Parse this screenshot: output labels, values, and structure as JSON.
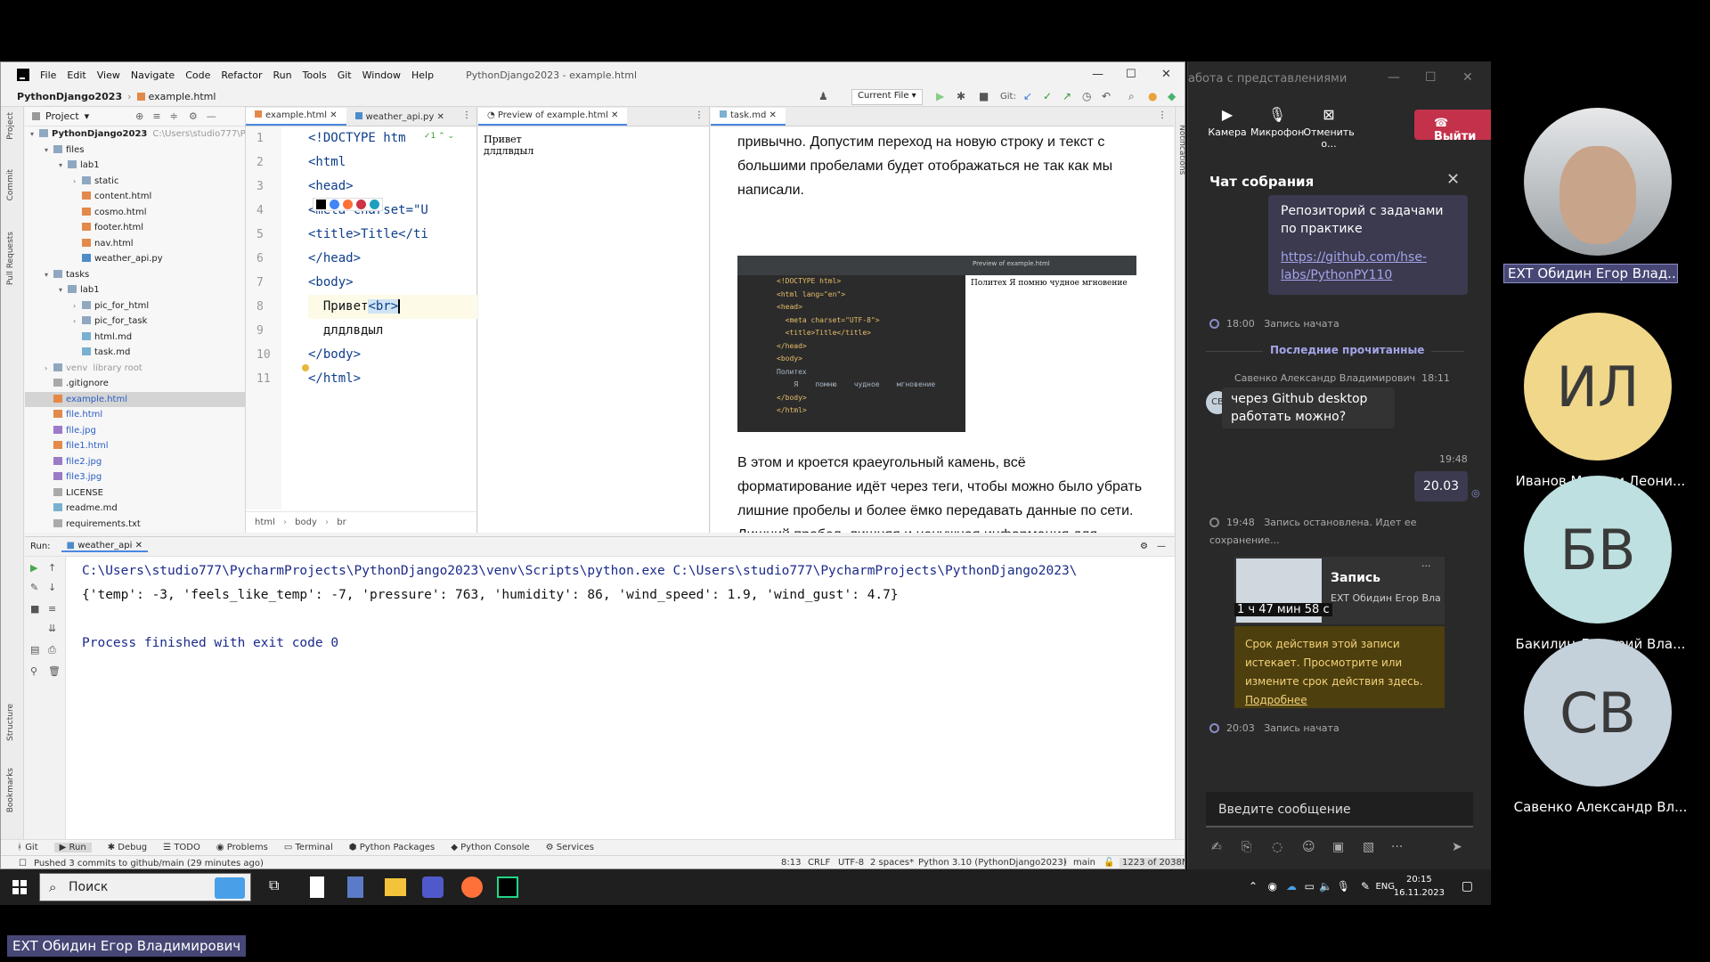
{
  "ide": {
    "menu": [
      "File",
      "Edit",
      "View",
      "Navigate",
      "Code",
      "Refactor",
      "Run",
      "Tools",
      "Git",
      "Window",
      "Help"
    ],
    "title": "PythonDjango2023 - example.html",
    "nav_project": "PythonDjango2023",
    "nav_file": "example.html",
    "run_config": "Current File",
    "git_label": "Git:",
    "left_strip": [
      "Project",
      "Commit",
      "Pull Requests",
      "Structure",
      "Bookmarks"
    ],
    "right_strip": "Notifications",
    "project_label": "Project",
    "tree": [
      {
        "label": "PythonDjango2023",
        "extra": "C:\\Users\\studio777\\Py",
        "indent": 0,
        "type": "folder",
        "arrow": "▾",
        "bold": true
      },
      {
        "label": "files",
        "indent": 1,
        "type": "folder",
        "arrow": "▾"
      },
      {
        "label": "lab1",
        "indent": 2,
        "type": "folder",
        "arrow": "▾"
      },
      {
        "label": "static",
        "indent": 3,
        "type": "folder",
        "arrow": "›"
      },
      {
        "label": "content.html",
        "indent": 3,
        "type": "fhtml"
      },
      {
        "label": "cosmo.html",
        "indent": 3,
        "type": "fhtml"
      },
      {
        "label": "footer.html",
        "indent": 3,
        "type": "fhtml"
      },
      {
        "label": "nav.html",
        "indent": 3,
        "type": "fhtml"
      },
      {
        "label": "weather_api.py",
        "indent": 3,
        "type": "fpy"
      },
      {
        "label": "tasks",
        "indent": 1,
        "type": "folder",
        "arrow": "▾"
      },
      {
        "label": "lab1",
        "indent": 2,
        "type": "folder",
        "arrow": "▾"
      },
      {
        "label": "pic_for_html",
        "indent": 3,
        "type": "folder",
        "arrow": "›"
      },
      {
        "label": "pic_for_task",
        "indent": 3,
        "type": "folder",
        "arrow": "›"
      },
      {
        "label": "html.md",
        "indent": 3,
        "type": "fmd"
      },
      {
        "label": "task.md",
        "indent": 3,
        "type": "fmd"
      },
      {
        "label": "venv",
        "extra": "library root",
        "indent": 1,
        "type": "folder",
        "arrow": "›",
        "gray": true
      },
      {
        "label": ".gitignore",
        "indent": 1,
        "type": "ftxt"
      },
      {
        "label": "example.html",
        "indent": 1,
        "type": "fhtml",
        "selected": true,
        "blue": true
      },
      {
        "label": "file.html",
        "indent": 1,
        "type": "fhtml",
        "blue": true
      },
      {
        "label": "file.jpg",
        "indent": 1,
        "type": "fjpg",
        "blue": true
      },
      {
        "label": "file1.html",
        "indent": 1,
        "type": "fhtml",
        "blue": true
      },
      {
        "label": "file2.jpg",
        "indent": 1,
        "type": "fjpg",
        "blue": true
      },
      {
        "label": "file3.jpg",
        "indent": 1,
        "type": "fjpg",
        "blue": true
      },
      {
        "label": "LICENSE",
        "indent": 1,
        "type": "ftxt"
      },
      {
        "label": "readme.md",
        "indent": 1,
        "type": "fmd"
      },
      {
        "label": "requirements.txt",
        "indent": 1,
        "type": "ftxt"
      }
    ],
    "editor_tabs": [
      "example.html",
      "weather_api.py"
    ],
    "preview_tab": "Preview of example.html",
    "md_tab": "task.md",
    "line_numbers": [
      "1",
      "2",
      "3",
      "4",
      "5",
      "6",
      "7",
      "8",
      "9",
      "10",
      "11"
    ],
    "code_lines": [
      {
        "html": "<!DOCTYPE htm"
      },
      {
        "html": "<html"
      },
      {
        "html": "<head>"
      },
      {
        "html": "    <meta charset=\"U"
      },
      {
        "html": "    <title>Title</ti"
      },
      {
        "html": "</head>"
      },
      {
        "html": "<body>"
      },
      {
        "text": "  Привет",
        "tag": "<br>"
      },
      {
        "text": "  длдлвдыл"
      },
      {
        "html": "</body>"
      },
      {
        "html": "</html>"
      }
    ],
    "breadcrumb": [
      "html",
      "body",
      "br"
    ],
    "preview_text": [
      "Привет",
      "длдлвдыл"
    ],
    "md_para1": "привычно. Допустим переход на новую строку и текст с большими пробелами будет отображаться не так как мы написали.",
    "md_para2": "В этом и кроется краеугольный камень, всё форматирование идёт через теги, чтобы можно было убрать лишние пробелы и более ёмко передавать данные по сети. Лишний пробел, лишняя и ненужная информация для компьютера, хотя человеку и приятнее",
    "md_img_code": [
      "<!DOCTYPE html>",
      "<html lang=\"en\">",
      "<head>",
      "  <meta charset=\"UTF-8\">",
      "  <title>Title</title>",
      "</head>",
      "<body>",
      "Политех",
      "    Я    помню    чудное    мгновение",
      "</body>",
      "</html>"
    ],
    "md_img_preview": "Политех Я помню чудное мгновение",
    "md_img_tab": "Preview of example.html",
    "run_label": "Run:",
    "run_config_tab": "weather_api",
    "output": {
      "cmd": "C:\\Users\\studio777\\PycharmProjects\\PythonDjango2023\\venv\\Scripts\\python.exe C:\\Users\\studio777\\PycharmProjects\\PythonDjango2023\\",
      "result": "{'temp': -3, 'feels_like_temp': -7, 'pressure': 763, 'humidity': 86, 'wind_speed': 1.9, 'wind_gust': 4.7}",
      "exit": "Process finished with exit code 0"
    },
    "bottom_tabs": [
      "Git",
      "Run",
      "Debug",
      "TODO",
      "Problems",
      "Terminal",
      "Python Packages",
      "Python Console",
      "Services"
    ],
    "status_msg": "Pushed 3 commits to github/main (29 minutes ago)",
    "status_right": {
      "pos": "8:13",
      "eol": "CRLF",
      "enc": "UTF-8",
      "indent": "2 spaces*",
      "interp": "Python 3.10 (PythonDjango2023)",
      "branch": "main",
      "mem": "1223 of 2038M"
    }
  },
  "taskbar": {
    "search": "Поиск",
    "lang": "ENG",
    "time": "20:15",
    "date": "16.11.2023"
  },
  "teams": {
    "window_title": "абота с представлениями",
    "controls": [
      "Камера",
      "Микрофон",
      "Отменить о..."
    ],
    "leave": "Выйти",
    "chat_title": "Чат собрания",
    "repo_msg": "Репозиторий с задачами по практике",
    "repo_link": "https://github.com/hse-labs/PythonPY110",
    "rec_start1_time": "18:00",
    "rec_start1": "Запись начата",
    "last_read": "Последние прочитанные",
    "msg_author": "Савенко Александр Владимирович",
    "msg_author_time": "18:11",
    "msg_author_initials": "СВ",
    "msg_text": "через Github desktop работать можно?",
    "my_time": "19:48",
    "my_msg": "20.03",
    "rec_stop_time": "19:48",
    "rec_stop": "Запись остановлена. Идет ее сохранение...",
    "rec_card_title": "Запись",
    "rec_card_author": "EXT Обидин Егор Владимирович",
    "rec_card_duration": "1 ч 47 мин 58 с",
    "expire_notice": "Срок действия этой записи истекает. Просмотрите или измените срок действия здесь.",
    "expire_link": "Подробнее",
    "rec_start2_time": "20:03",
    "rec_start2": "Запись начата",
    "input_placeholder": "Введите сообщение"
  },
  "participants": [
    {
      "name": "EXT Обидин Егор Влад...",
      "initials": "",
      "color": "#6b6b6b",
      "video": true
    },
    {
      "name": "Иванов Максим Леони...",
      "initials": "ИЛ",
      "color": "#f0d78a"
    },
    {
      "name": "Бакилин Дмитрий Вла...",
      "initials": "БВ",
      "color": "#bfe0e0"
    },
    {
      "name": "Савенко Александр Вл...",
      "initials": "СВ",
      "color": "#c4d0da"
    }
  ],
  "presenter_label": "EXT Обидин Егор Владимирович"
}
